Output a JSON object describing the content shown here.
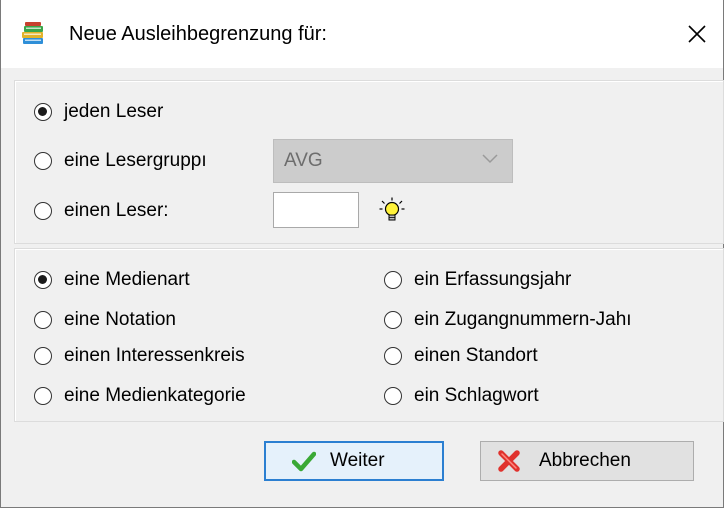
{
  "dialog": {
    "title": "Neue Ausleihbegrenzung für:",
    "close_symbol": "✕"
  },
  "target_group": {
    "options": [
      {
        "label": "jeden Leser",
        "checked": true
      },
      {
        "label": "eine Lesergruppı",
        "checked": false
      },
      {
        "label": "einen Leser:",
        "checked": false
      }
    ],
    "group_select": {
      "value": "AVG",
      "disabled": true
    },
    "reader_input": {
      "value": ""
    },
    "bulb_icon": "lightbulb-icon"
  },
  "criteria": {
    "left": [
      {
        "label": "eine Medienart",
        "checked": true
      },
      {
        "label": "eine Notation",
        "checked": false
      },
      {
        "label": "einen Interessenkreis",
        "checked": false
      },
      {
        "label": "eine Medienkategorie",
        "checked": false
      }
    ],
    "right": [
      {
        "label": "ein Erfassungsjahr",
        "checked": false
      },
      {
        "label": "ein Zugangnummern-Jahı",
        "checked": false
      },
      {
        "label": "einen Standort",
        "checked": false
      },
      {
        "label": "ein Schlagwort",
        "checked": false
      }
    ]
  },
  "buttons": {
    "weiter": {
      "label": "Weiter",
      "icon": "checkmark-icon",
      "icon_color": "#3aa935"
    },
    "abbrechen": {
      "label": "Abbrechen",
      "icon": "red-x-icon",
      "icon_color": "#e0322d"
    }
  },
  "colors": {
    "focus_border": "#2b7fd1",
    "disabled_select": "#cccccc"
  }
}
